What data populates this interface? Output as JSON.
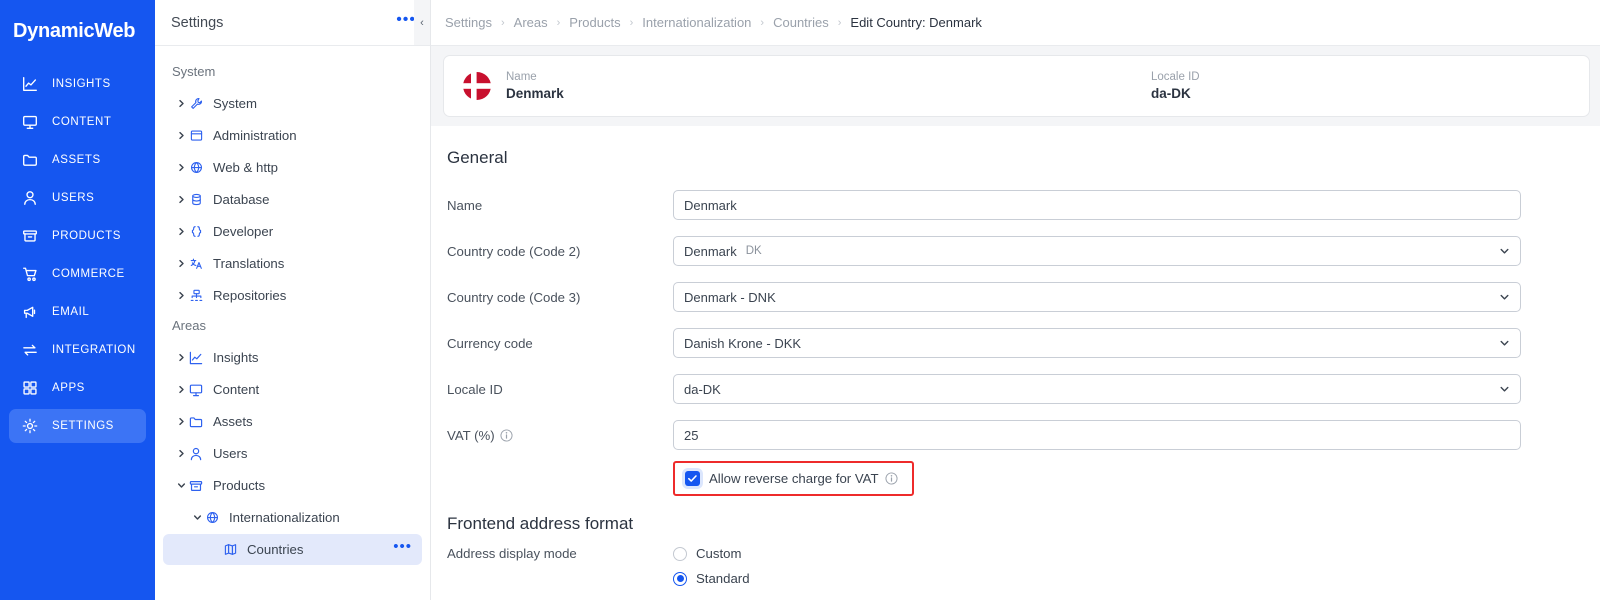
{
  "brand": {
    "name": "DynamicWeb"
  },
  "rail": {
    "items": [
      {
        "label": "INSIGHTS",
        "icon": "insights-icon",
        "active": false
      },
      {
        "label": "CONTENT",
        "icon": "monitor-icon",
        "active": false
      },
      {
        "label": "ASSETS",
        "icon": "folder-icon",
        "active": false
      },
      {
        "label": "USERS",
        "icon": "user-icon",
        "active": false
      },
      {
        "label": "PRODUCTS",
        "icon": "box-icon",
        "active": false
      },
      {
        "label": "COMMERCE",
        "icon": "cart-icon",
        "active": false
      },
      {
        "label": "EMAIL",
        "icon": "megaphone-icon",
        "active": false
      },
      {
        "label": "INTEGRATION",
        "icon": "arrows-icon",
        "active": false
      },
      {
        "label": "APPS",
        "icon": "grid-icon",
        "active": false
      },
      {
        "label": "SETTINGS",
        "icon": "gear-icon",
        "active": true
      }
    ]
  },
  "panel": {
    "title": "Settings",
    "menu_dots": "•••",
    "collapse_glyph": "‹",
    "groups": [
      {
        "label": "System",
        "items": [
          {
            "label": "System",
            "icon": "wrench-icon"
          },
          {
            "label": "Administration",
            "icon": "window-icon"
          },
          {
            "label": "Web & http",
            "icon": "globe-icon"
          },
          {
            "label": "Database",
            "icon": "database-icon"
          },
          {
            "label": "Developer",
            "icon": "braces-icon"
          },
          {
            "label": "Translations",
            "icon": "translate-icon"
          },
          {
            "label": "Repositories",
            "icon": "repository-icon"
          }
        ]
      },
      {
        "label": "Areas",
        "items": [
          {
            "label": "Insights",
            "icon": "insights-icon"
          },
          {
            "label": "Content",
            "icon": "monitor-icon"
          },
          {
            "label": "Assets",
            "icon": "folder-icon"
          },
          {
            "label": "Users",
            "icon": "user-icon"
          },
          {
            "label": "Products",
            "icon": "box-icon"
          },
          {
            "label": "Internationalization",
            "icon": "globe-icon"
          },
          {
            "label": "Countries",
            "icon": "map-icon"
          }
        ]
      }
    ]
  },
  "breadcrumb": {
    "separator": "›",
    "items": [
      "Settings",
      "Areas",
      "Products",
      "Internationalization",
      "Countries",
      "Edit Country: Denmark"
    ]
  },
  "headercard": {
    "flag": "denmark-flag-icon",
    "name_label": "Name",
    "name_value": "Denmark",
    "locale_label": "Locale ID",
    "locale_value": "da-DK"
  },
  "general": {
    "title": "General",
    "fields": [
      {
        "label": "Name",
        "value": "Denmark",
        "sub": "",
        "type": "text"
      },
      {
        "label": "Country code (Code 2)",
        "value": "Denmark",
        "sub": "DK",
        "type": "select"
      },
      {
        "label": "Country code (Code 3)",
        "value": "Denmark - DNK",
        "sub": "",
        "type": "select"
      },
      {
        "label": "Currency code",
        "value": "Danish Krone - DKK",
        "sub": "",
        "type": "select"
      },
      {
        "label": "Locale ID",
        "value": "da-DK",
        "sub": "",
        "type": "select"
      },
      {
        "label": "VAT (%)",
        "value": "25",
        "sub": "",
        "type": "text",
        "info": true
      }
    ],
    "checkbox": {
      "label": "Allow reverse charge for VAT",
      "checked": true,
      "highlighted": true,
      "highlight_color": "#ee2b2b"
    }
  },
  "frontend": {
    "title": "Frontend address format",
    "mode_label": "Address display mode",
    "options": [
      {
        "label": "Custom",
        "selected": false
      },
      {
        "label": "Standard",
        "selected": true
      }
    ]
  },
  "colors": {
    "brand_blue": "#1556f0",
    "rail_active": "#3c74f5",
    "panel_selected": "#e3e9fb",
    "highlight_red": "#ee2b2b",
    "flag_red": "#c8102e"
  }
}
